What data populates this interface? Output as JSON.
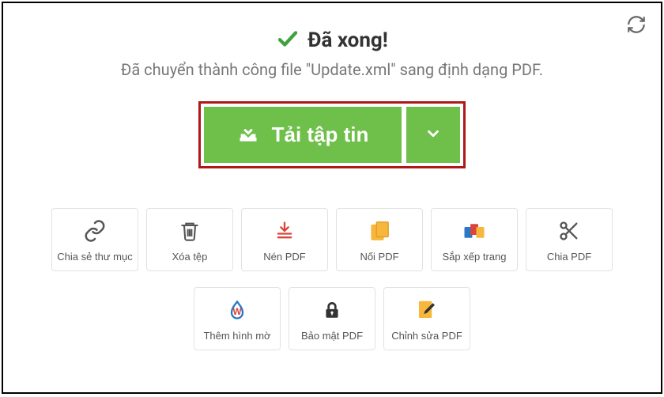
{
  "header": {
    "done": "Đã xong!",
    "subtitle": "Đã chuyển thành công file \"Update.xml\" sang định dạng PDF."
  },
  "download": {
    "label": "Tải tập tin"
  },
  "actions": [
    {
      "label": "Chia sẻ thư mục"
    },
    {
      "label": "Xóa tệp"
    },
    {
      "label": "Nén PDF"
    },
    {
      "label": "Nối PDF"
    },
    {
      "label": "Sắp xếp trang"
    },
    {
      "label": "Chia PDF"
    },
    {
      "label": "Thêm hình mờ"
    },
    {
      "label": "Bảo mật PDF"
    },
    {
      "label": "Chỉnh sửa PDF"
    }
  ]
}
